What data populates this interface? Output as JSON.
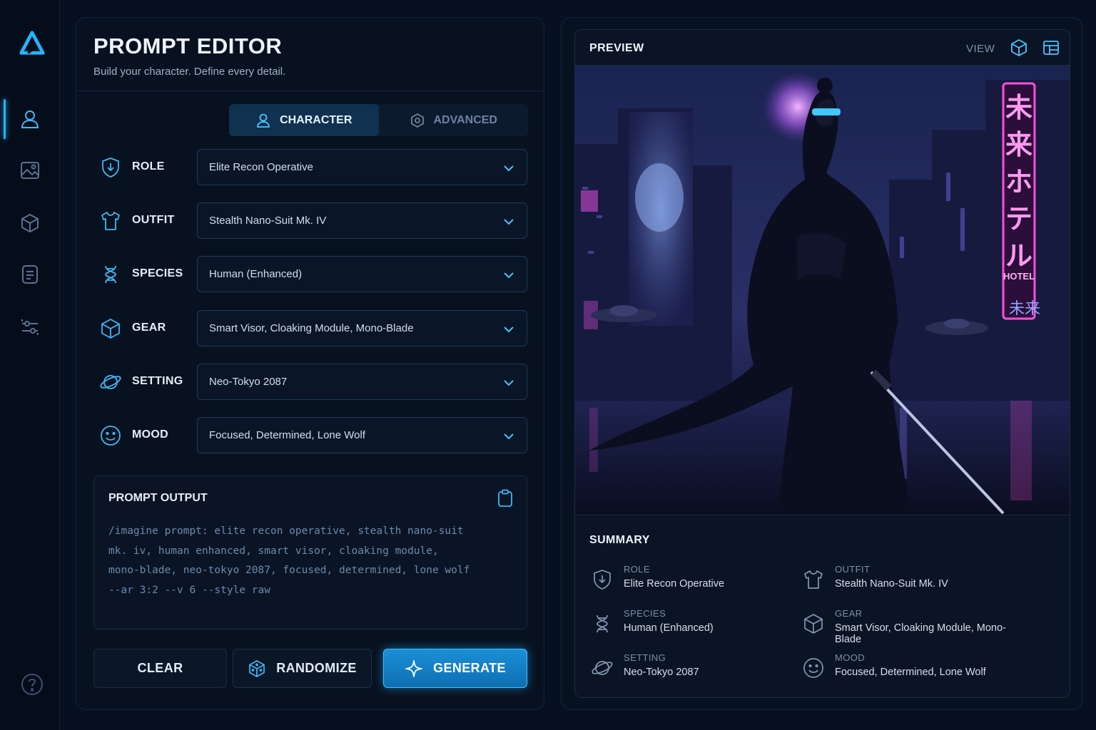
{
  "editor": {
    "title": "PROMPT EDITOR",
    "subtitle": "Build your character. Define every detail.",
    "tabs": [
      {
        "label": "CHARACTER",
        "icon": "user-icon",
        "active": true
      },
      {
        "label": "ADVANCED",
        "icon": "hexagon-icon",
        "active": false
      }
    ],
    "fields": [
      {
        "label": "ROLE",
        "value": "Elite Recon Operative",
        "icon": "shield-icon"
      },
      {
        "label": "OUTFIT",
        "value": "Stealth Nano-Suit Mk. IV",
        "icon": "shirt-icon"
      },
      {
        "label": "SPECIES",
        "value": "Human (Enhanced)",
        "icon": "dna-icon"
      },
      {
        "label": "GEAR",
        "value": "Smart Visor, Cloaking Module, Mono-Blade",
        "icon": "cube-icon"
      },
      {
        "label": "SETTING",
        "value": "Neo-Tokyo 2087",
        "icon": "planet-icon"
      },
      {
        "label": "MOOD",
        "value": "Focused, Determined, Lone Wolf",
        "icon": "smiley-icon"
      }
    ],
    "output": {
      "title": "PROMPT OUTPUT",
      "lines": [
        "/imagine prompt: elite recon operative, stealth nano-suit",
        "mk. iv, human enhanced, smart visor, cloaking module,",
        "mono-blade, neo-tokyo 2087, focused, determined, lone wolf",
        "--ar 3:2 --v 6 --style raw"
      ]
    },
    "buttons": {
      "clear": "CLEAR",
      "randomize": "RANDOMIZE",
      "generate": "GENERATE"
    }
  },
  "preview": {
    "title": "PREVIEW",
    "view_label": "VIEW",
    "artwork": {
      "sign_kanji": [
        "未",
        "来",
        "ホ",
        "テ",
        "ル"
      ],
      "sign_small": "HOTEL",
      "sign_lower": "未来"
    },
    "summary": {
      "title": "SUMMARY",
      "items": [
        {
          "label": "ROLE",
          "value": "Elite Recon Operative"
        },
        {
          "label": "OUTFIT",
          "value": "Stealth Nano-Suit Mk. IV"
        },
        {
          "label": "SPECIES",
          "value": "Human (Enhanced)"
        },
        {
          "label": "GEAR",
          "value": "Smart Visor, Cloaking Module, Mono-Blade"
        },
        {
          "label": "SETTING",
          "value": "Neo-Tokyo 2087"
        },
        {
          "label": "MOOD",
          "value": "Focused, Determined, Lone Wolf"
        }
      ]
    }
  },
  "colors": {
    "accent": "#22b5ff",
    "background": "#071020",
    "panel": "#08111f",
    "neon_pink": "#ff4fd8"
  }
}
